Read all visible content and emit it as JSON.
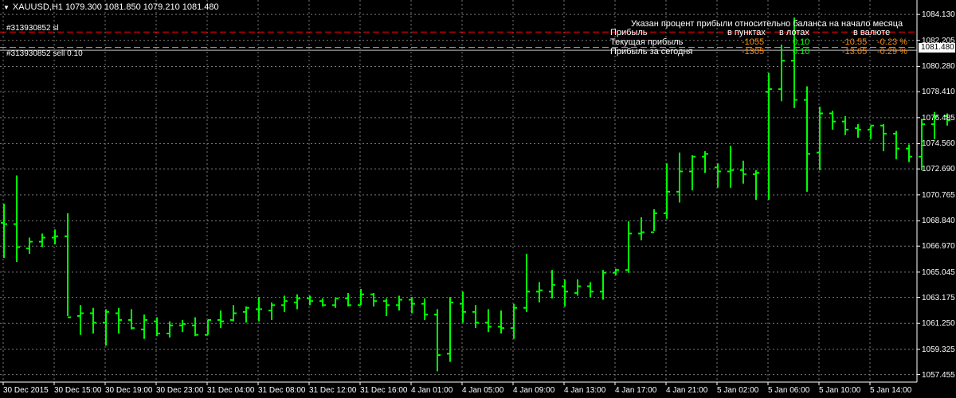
{
  "header": {
    "symbol_line": "XAUUSD,H1  1079.300 1081.850 1079.210 1081.480"
  },
  "orders": {
    "sl_label": "#313930852 sl",
    "sell_label": "#313930852 sell 0.10"
  },
  "colors": {
    "background": "#000000",
    "grid": "#7a7a7a",
    "candles": "#00ff00",
    "sl_line": "#ff0000",
    "order_line": "#00ff00",
    "price_line": "#c0c0c0",
    "negative_value": "#ff8c00",
    "lots_value": "#00ff00"
  },
  "profit_panel": {
    "title": "Указан процент прибыли относительно баланса на начало месяца",
    "headers": {
      "profit": "Прибыль",
      "points": "в пунктах",
      "lots": "в лотах",
      "currency": "в валюте"
    },
    "current": {
      "label": "Текущая прибыль",
      "points": "-1055",
      "lots": "0.10",
      "currency": "-10.55",
      "percent": "-0.23 %"
    },
    "today": {
      "label": "Прибыль за сегодня",
      "points": "-1305",
      "lots": "0.10",
      "currency": "-13.05",
      "percent": "-0.29 %"
    }
  },
  "price_axis": {
    "labels": [
      "1084.130",
      "1082.205",
      "1080.280",
      "1078.410",
      "1076.485",
      "1074.560",
      "1072.690",
      "1070.765",
      "1068.840",
      "1066.970",
      "1065.045",
      "1063.175",
      "1061.250",
      "1059.325",
      "1057.455"
    ],
    "current_price": "1081.480"
  },
  "time_axis": {
    "labels": [
      "30 Dec 2015",
      "30 Dec 15:00",
      "30 Dec 19:00",
      "30 Dec 23:00",
      "31 Dec 04:00",
      "31 Dec 08:00",
      "31 Dec 12:00",
      "31 Dec 16:00",
      "4 Jan 01:00",
      "4 Jan 05:00",
      "4 Jan 09:00",
      "4 Jan 13:00",
      "4 Jan 17:00",
      "4 Jan 21:00",
      "5 Jan 02:00",
      "5 Jan 06:00",
      "5 Jan 10:00",
      "5 Jan 14:00"
    ]
  },
  "chart_data": {
    "type": "ohlc",
    "symbol": "XAUUSD",
    "timeframe": "H1",
    "ylim": [
      1056.9,
      1085.2
    ],
    "sl_price": 1082.83,
    "order_price": 1081.69,
    "current_price": 1081.48,
    "bars": [
      [
        1068.7,
        1070.1,
        1066.1,
        1068.6
      ],
      [
        1068.6,
        1072.2,
        1065.8,
        1066.9
      ],
      [
        1066.8,
        1067.6,
        1066.4,
        1067.3
      ],
      [
        1067.3,
        1067.9,
        1066.9,
        1067.6
      ],
      [
        1067.6,
        1068.2,
        1067.1,
        1067.7
      ],
      [
        1067.7,
        1069.4,
        1061.8,
        1061.7
      ],
      [
        1061.8,
        1062.6,
        1060.4,
        1062.0
      ],
      [
        1062.0,
        1062.4,
        1060.5,
        1061.3
      ],
      [
        1061.3,
        1062.3,
        1059.6,
        1062.1
      ],
      [
        1062.0,
        1062.4,
        1060.5,
        1061.5
      ],
      [
        1061.5,
        1062.3,
        1060.8,
        1060.9
      ],
      [
        1060.8,
        1061.9,
        1060.1,
        1061.5
      ],
      [
        1061.4,
        1061.7,
        1060.3,
        1060.5
      ],
      [
        1060.5,
        1061.4,
        1060.2,
        1061.1
      ],
      [
        1061.1,
        1061.5,
        1060.6,
        1061.2
      ],
      [
        1061.1,
        1061.7,
        1060.3,
        1060.4
      ],
      [
        1060.4,
        1061.5,
        1060.4,
        1061.5
      ],
      [
        1061.5,
        1062.2,
        1060.9,
        1061.4
      ],
      [
        1061.5,
        1062.6,
        1061.4,
        1062.0
      ],
      [
        1062.1,
        1062.5,
        1061.3,
        1062.4
      ],
      [
        1062.3,
        1063.2,
        1061.4,
        1062.3
      ],
      [
        1062.2,
        1062.8,
        1061.5,
        1062.6
      ],
      [
        1062.6,
        1063.3,
        1062.1,
        1062.9
      ],
      [
        1062.8,
        1063.4,
        1062.3,
        1063.1
      ],
      [
        1063.1,
        1063.3,
        1062.6,
        1062.9
      ],
      [
        1062.9,
        1063.1,
        1062.5,
        1062.6
      ],
      [
        1062.6,
        1063.1,
        1062.4,
        1063.1
      ],
      [
        1063.1,
        1063.5,
        1062.5,
        1062.6
      ],
      [
        1062.6,
        1063.8,
        1062.6,
        1063.4
      ],
      [
        1063.4,
        1063.5,
        1062.5,
        1062.9
      ],
      [
        1062.9,
        1063.1,
        1061.8,
        1062.6
      ],
      [
        1062.6,
        1063.3,
        1062.2,
        1063.0
      ],
      [
        1063.0,
        1063.2,
        1062.0,
        1062.7
      ],
      [
        1062.7,
        1063.1,
        1061.5,
        1061.9
      ],
      [
        1061.9,
        1062.3,
        1057.7,
        1058.9
      ],
      [
        1059.0,
        1063.2,
        1058.4,
        1062.8
      ],
      [
        1062.7,
        1063.6,
        1061.3,
        1062.1
      ],
      [
        1062.1,
        1062.6,
        1060.9,
        1061.3
      ],
      [
        1061.3,
        1062.3,
        1060.6,
        1061.0
      ],
      [
        1061.0,
        1062.2,
        1060.5,
        1060.9
      ],
      [
        1060.9,
        1062.7,
        1060.1,
        1062.4
      ],
      [
        1062.4,
        1066.4,
        1062.1,
        1063.6
      ],
      [
        1063.6,
        1064.3,
        1062.8,
        1063.7
      ],
      [
        1063.6,
        1065.2,
        1063.1,
        1064.1
      ],
      [
        1064.0,
        1064.5,
        1062.5,
        1063.6
      ],
      [
        1063.5,
        1064.5,
        1063.3,
        1064.0
      ],
      [
        1064.0,
        1064.3,
        1063.2,
        1063.6
      ],
      [
        1063.6,
        1065.2,
        1063.0,
        1065.0
      ],
      [
        1065.0,
        1065.3,
        1064.8,
        1065.2
      ],
      [
        1065.2,
        1068.8,
        1065.0,
        1067.9
      ],
      [
        1067.9,
        1069.1,
        1067.4,
        1068.0
      ],
      [
        1068.0,
        1069.7,
        1068.1,
        1069.4
      ],
      [
        1069.4,
        1073.1,
        1069.0,
        1071.0
      ],
      [
        1071.0,
        1073.9,
        1070.2,
        1072.5
      ],
      [
        1072.5,
        1073.7,
        1071.1,
        1073.6
      ],
      [
        1073.6,
        1074.0,
        1072.4,
        1073.8
      ],
      [
        1072.8,
        1073.1,
        1071.3,
        1072.5
      ],
      [
        1072.5,
        1074.4,
        1071.3,
        1072.6
      ],
      [
        1072.6,
        1073.3,
        1071.6,
        1072.3
      ],
      [
        1072.3,
        1072.6,
        1070.4,
        1072.4
      ],
      [
        1078.4,
        1079.8,
        1070.4,
        1078.6
      ],
      [
        1078.6,
        1081.9,
        1077.7,
        1080.7
      ],
      [
        1080.7,
        1083.9,
        1077.2,
        1077.8
      ],
      [
        1077.8,
        1078.8,
        1071.0,
        1073.8
      ],
      [
        1073.9,
        1077.3,
        1072.6,
        1076.8
      ],
      [
        1076.8,
        1077.0,
        1075.6,
        1076.2
      ],
      [
        1076.2,
        1076.6,
        1075.2,
        1075.6
      ],
      [
        1075.7,
        1076.0,
        1075.0,
        1075.6
      ],
      [
        1075.6,
        1075.9,
        1074.9,
        1075.9
      ],
      [
        1075.9,
        1076.0,
        1074.0,
        1075.3
      ],
      [
        1075.3,
        1075.5,
        1073.4,
        1074.2
      ],
      [
        1074.2,
        1074.5,
        1073.2,
        1073.6
      ],
      [
        1073.6,
        1076.4,
        1072.6,
        1076.0
      ],
      [
        1076.0,
        1076.9,
        1074.9,
        1076.6
      ],
      [
        1076.6,
        1076.8,
        1075.9,
        1076.3
      ],
      [
        1076.3,
        1076.7,
        1075.6,
        1076.4
      ],
      [
        1076.4,
        1077.2,
        1076.1,
        1076.7
      ],
      [
        1076.7,
        1077.6,
        1076.5,
        1077.2
      ],
      [
        1077.2,
        1078.1,
        1076.9,
        1077.7
      ],
      [
        1077.7,
        1078.6,
        1076.6,
        1078.2
      ],
      [
        1078.2,
        1079.2,
        1077.1,
        1078.5
      ],
      [
        1078.5,
        1079.6,
        1077.6,
        1078.1
      ],
      [
        1078.1,
        1078.6,
        1076.6,
        1076.9
      ],
      [
        1076.9,
        1077.5,
        1076.6,
        1077.1
      ],
      [
        1077.1,
        1079.2,
        1076.6,
        1077.6
      ],
      [
        1077.6,
        1080.4,
        1076.9,
        1078.0
      ],
      [
        1078.0,
        1080.6,
        1077.2,
        1079.9
      ],
      [
        1079.9,
        1081.2,
        1079.3,
        1079.5
      ],
      [
        1079.3,
        1081.9,
        1078.8,
        1081.5
      ]
    ]
  }
}
